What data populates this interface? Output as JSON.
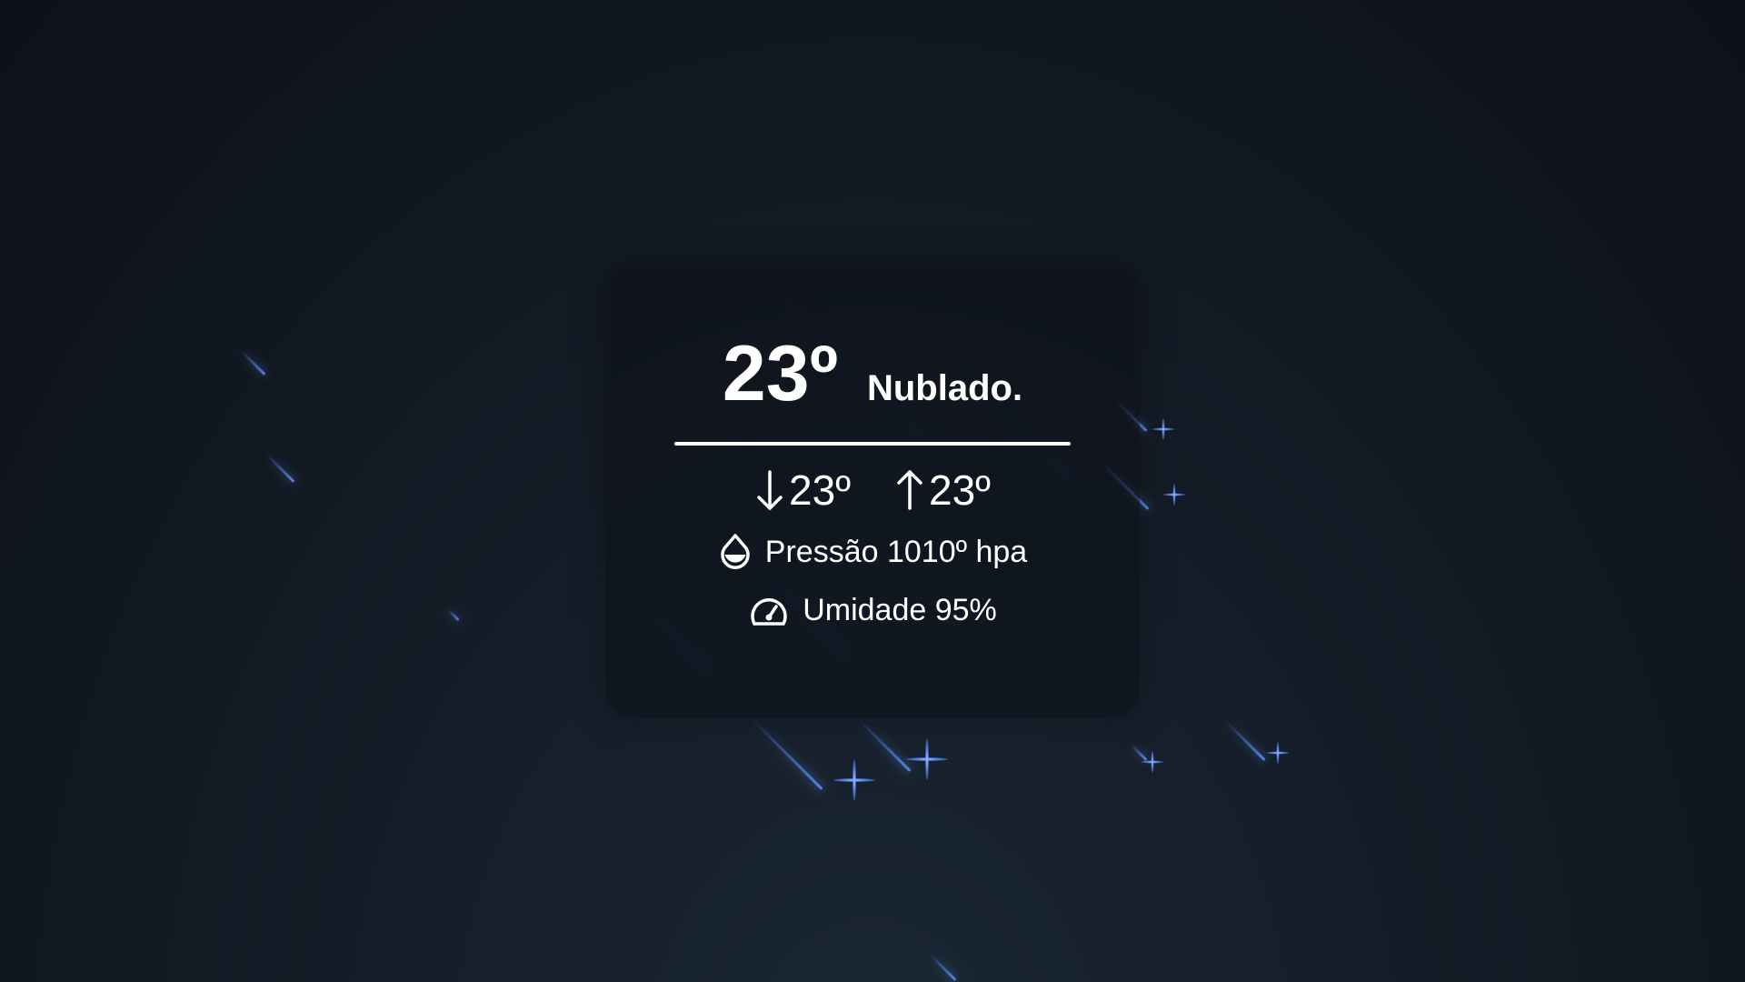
{
  "weather": {
    "temperature": "23º",
    "condition": "Nublado.",
    "min_temp": "23º",
    "max_temp": "23º",
    "pressure_text": "Pressão 1010º hpa",
    "humidity_text": "Umidade 95%"
  },
  "icons": {
    "min": "arrow-down-icon",
    "max": "arrow-up-icon",
    "pressure": "droplet-icon",
    "humidity": "gauge-icon"
  },
  "colors": {
    "background": "#141c27",
    "meteor": "#5f91ff",
    "text": "#ffffff"
  }
}
